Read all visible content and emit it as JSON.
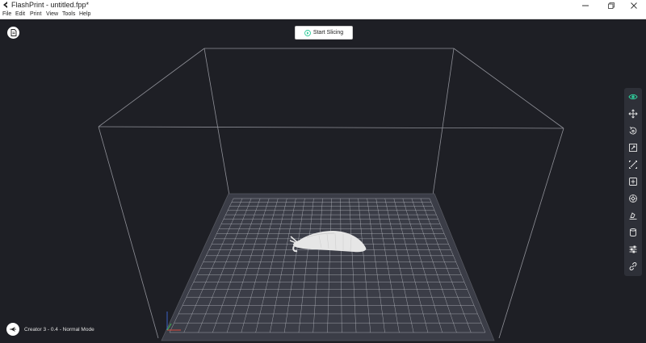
{
  "window": {
    "title": "FlashPrint - untitled.fpp*",
    "controls": [
      "minimize-icon",
      "restore-icon",
      "close-icon"
    ]
  },
  "menu": [
    "File",
    "Edit",
    "Print",
    "View",
    "Tools",
    "Help"
  ],
  "header": {
    "slice_label": "Start Slicing"
  },
  "toolbar": {
    "active_color": "#2ecc9a",
    "icon_color": "#e8e8e8",
    "tools": [
      "view-icon",
      "move-icon",
      "rotate-icon",
      "scale-icon",
      "cut-icon",
      "add-support-icon",
      "extruder-icon",
      "lay-flat-icon",
      "cylinder-icon",
      "settings-icon",
      "link-icon"
    ]
  },
  "status": {
    "text": "Creator 3 - 0.4 - Normal Mode"
  },
  "colors": {
    "background": "#1e1f25",
    "platform": "#3b3d47",
    "grid": "#bfc1c8",
    "frame": "#8f9098",
    "model": "#ececec"
  }
}
